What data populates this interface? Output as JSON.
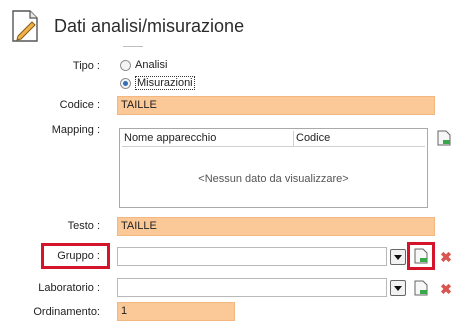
{
  "header": {
    "title": "Dati analisi/misurazione",
    "icon": "document-edit-icon"
  },
  "form": {
    "tipo": {
      "label": "Tipo :",
      "options": [
        "Analisi",
        "Misurazioni"
      ],
      "selected": "Misurazioni"
    },
    "codice": {
      "label": "Codice :",
      "value": "TAILLE"
    },
    "mapping": {
      "label": "Mapping :",
      "columns": [
        "Nome apparecchio",
        "Codice"
      ],
      "empty_text": "<Nessun dato da visualizzare>"
    },
    "testo": {
      "label": "Testo :",
      "value": "TAILLE"
    },
    "gruppo": {
      "label": "Gruppo :",
      "value": ""
    },
    "laboratorio": {
      "label": "Laboratorio :",
      "value": ""
    },
    "ordinamento": {
      "label": "Ordinamento:",
      "value": "1"
    }
  },
  "colors": {
    "required_field": "#fbc997",
    "highlight": "#d4142a",
    "delete": "#d9534f"
  }
}
